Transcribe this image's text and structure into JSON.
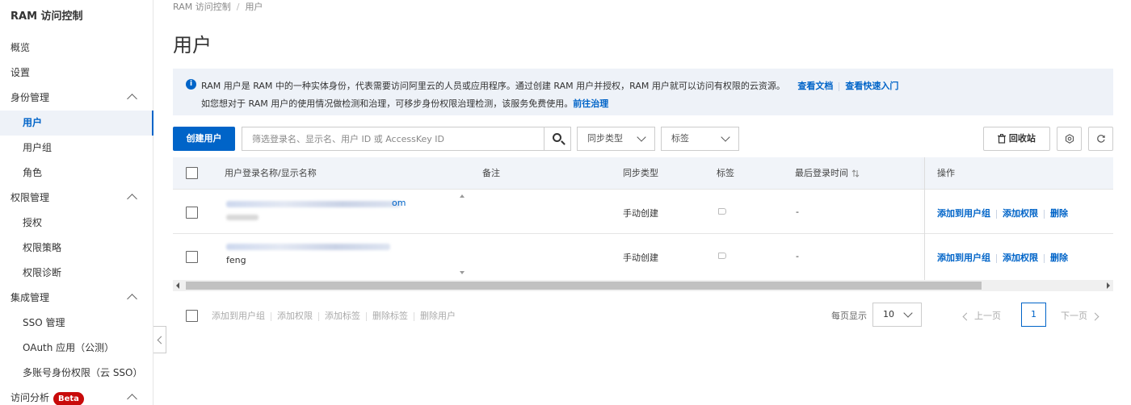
{
  "sidebar": {
    "title": "RAM 访问控制",
    "items": [
      {
        "label": "概览"
      },
      {
        "label": "设置"
      },
      {
        "label": "身份管理"
      },
      {
        "label": "用户"
      },
      {
        "label": "用户组"
      },
      {
        "label": "角色"
      },
      {
        "label": "权限管理"
      },
      {
        "label": "授权"
      },
      {
        "label": "权限策略"
      },
      {
        "label": "权限诊断"
      },
      {
        "label": "集成管理"
      },
      {
        "label": "SSO 管理"
      },
      {
        "label": "OAuth 应用（公测）"
      },
      {
        "label": "多账号身份权限（云 SSO）"
      },
      {
        "label": "访问分析",
        "badge": "Beta"
      }
    ]
  },
  "breadcrumb": [
    "RAM 访问控制",
    "/",
    "用户"
  ],
  "page_title": "用户",
  "notice": {
    "line1": "RAM 用户是 RAM 中的一种实体身份，代表需要访问阿里云的人员或应用程序。通过创建 RAM 用户并授权，RAM 用户就可以访问有权限的云资源。",
    "link_docs": "查看文档",
    "link_quickstart": "查看快速入门",
    "line2": "如您想对于 RAM 用户的使用情况做检测和治理，可移步身份权限治理检测，该服务免费使用。",
    "link_govern": "前往治理"
  },
  "toolbar": {
    "create_label": "创建用户",
    "search_placeholder": "筛选登录名、显示名、用户 ID 或 AccessKey ID",
    "sync_type_label": "同步类型",
    "tag_label": "标签",
    "recycle_label": "回收站"
  },
  "table": {
    "headers": {
      "name": "用户登录名称/显示名称",
      "note": "备注",
      "sync": "同步类型",
      "tag": "标签",
      "last_login": "最后登录时间",
      "ops": "操作"
    },
    "rows": [
      {
        "login_suffix": "om",
        "display": "",
        "note": "",
        "sync": "手动创建",
        "last_login": "-",
        "op1": "添加到用户组",
        "op2": "添加权限",
        "op3": "删除"
      },
      {
        "login_suffix": "",
        "display": "feng",
        "note": "",
        "sync": "手动创建",
        "last_login": "-",
        "op1": "添加到用户组",
        "op2": "添加权限",
        "op3": "删除"
      }
    ]
  },
  "bulk_actions": [
    "添加到用户组",
    "添加权限",
    "添加标签",
    "删除标签",
    "删除用户"
  ],
  "pagination": {
    "per_page_label": "每页显示",
    "per_page_value": "10",
    "prev": "上一页",
    "current": "1",
    "next": "下一页"
  },
  "colors": {
    "primary": "#0064c8",
    "badge": "#c80a0a",
    "notice_bg": "#eef2f8"
  }
}
